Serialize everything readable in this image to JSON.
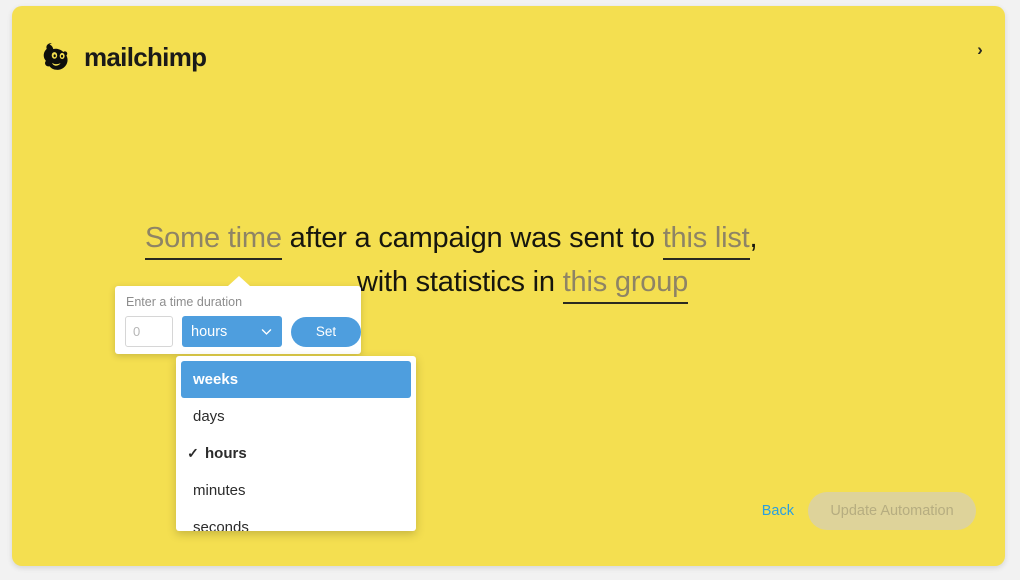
{
  "theme": {
    "canvas_bg": "#f2f2f2",
    "card_bg": "#f4df50",
    "accent_blue": "#4e9ede",
    "link_blue": "#2a9fe0",
    "slot_text": "#8e8465",
    "disabled_button_bg": "#ded39a",
    "disabled_button_text": "#b6ad80"
  },
  "header": {
    "brand_name": "mailchimp",
    "logo_icon": "mailchimp-freddie-icon",
    "next_icon": "chevron-right-icon",
    "next_label": "›"
  },
  "sentence": {
    "line1": [
      {
        "type": "slot",
        "text": "Some time",
        "name": "slot-time-delay"
      },
      {
        "type": "plain",
        "text": " after a campaign was sent to "
      },
      {
        "type": "slot",
        "text": "this list",
        "name": "slot-list"
      },
      {
        "type": "plain",
        "text": ","
      }
    ],
    "line2": [
      {
        "type": "plain",
        "text": "with statistics in "
      },
      {
        "type": "slot",
        "text": "this group",
        "name": "slot-group"
      }
    ],
    "slot_time": "Some time",
    "text_after_time": " after a campaign was sent to ",
    "slot_list": "this list",
    "comma": ",",
    "text_line2_prefix": "with statistics in ",
    "slot_group": "this group"
  },
  "popover": {
    "label": "Enter a time duration",
    "amount_value": "",
    "amount_placeholder": "0",
    "unit_selected": "hours",
    "unit_chevron_icon": "chevron-down-icon",
    "set_label": "Set"
  },
  "dropdown": {
    "options": [
      {
        "label": "weeks",
        "highlighted": true,
        "selected": false
      },
      {
        "label": "days",
        "highlighted": false,
        "selected": false
      },
      {
        "label": "hours",
        "highlighted": false,
        "selected": true
      },
      {
        "label": "minutes",
        "highlighted": false,
        "selected": false
      },
      {
        "label": "seconds",
        "highlighted": false,
        "selected": false
      }
    ],
    "check_icon": "check-icon",
    "check_glyph": "✓",
    "opt0": "weeks",
    "opt1": "days",
    "opt2": "hours",
    "opt3": "minutes",
    "opt4": "seconds"
  },
  "footer": {
    "back_label": "Back",
    "update_label": "Update Automation",
    "update_disabled": true
  }
}
